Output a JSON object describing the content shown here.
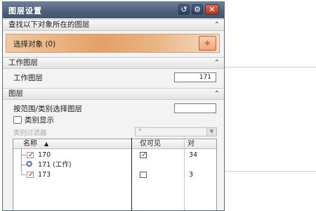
{
  "window": {
    "title": "图层设置",
    "reset_glyph": "↺",
    "gear_glyph": "⚙",
    "close_glyph": "✕"
  },
  "sections": {
    "find": {
      "title": "查找以下对象所在的图层",
      "collapse_glyph": "⌃"
    },
    "work_layer": {
      "title": "工作图层",
      "collapse_glyph": "⌃"
    },
    "layers": {
      "title": "图层",
      "collapse_glyph": "⌃"
    }
  },
  "find_object": {
    "label": "选择对象 (0)",
    "crosshair_glyph": "⌖"
  },
  "work_layer": {
    "label": "工作图层",
    "value": "171"
  },
  "layer_filter": {
    "label": "按范围/类别选择图层",
    "value": ""
  },
  "category_display": {
    "label": "类别显示",
    "checked": false
  },
  "category_filter": {
    "label": "类别过滤器",
    "value": "*",
    "arrow": "▼"
  },
  "table": {
    "headers": {
      "name": "名称",
      "sort_glyph": "▲",
      "visible_only": "仅可见",
      "object_count": "对"
    },
    "rows": [
      {
        "name": "170",
        "visible_only": true,
        "count": "34"
      },
      {
        "name": "171 (工作)",
        "visible_only": null,
        "count": ""
      },
      {
        "name": "173",
        "visible_only": false,
        "count": "3"
      }
    ]
  },
  "colors": {
    "titlebar": "#4f607c",
    "select_band": "#e4a067",
    "close_button": "#b8321c",
    "check_mark": "#c02020"
  }
}
